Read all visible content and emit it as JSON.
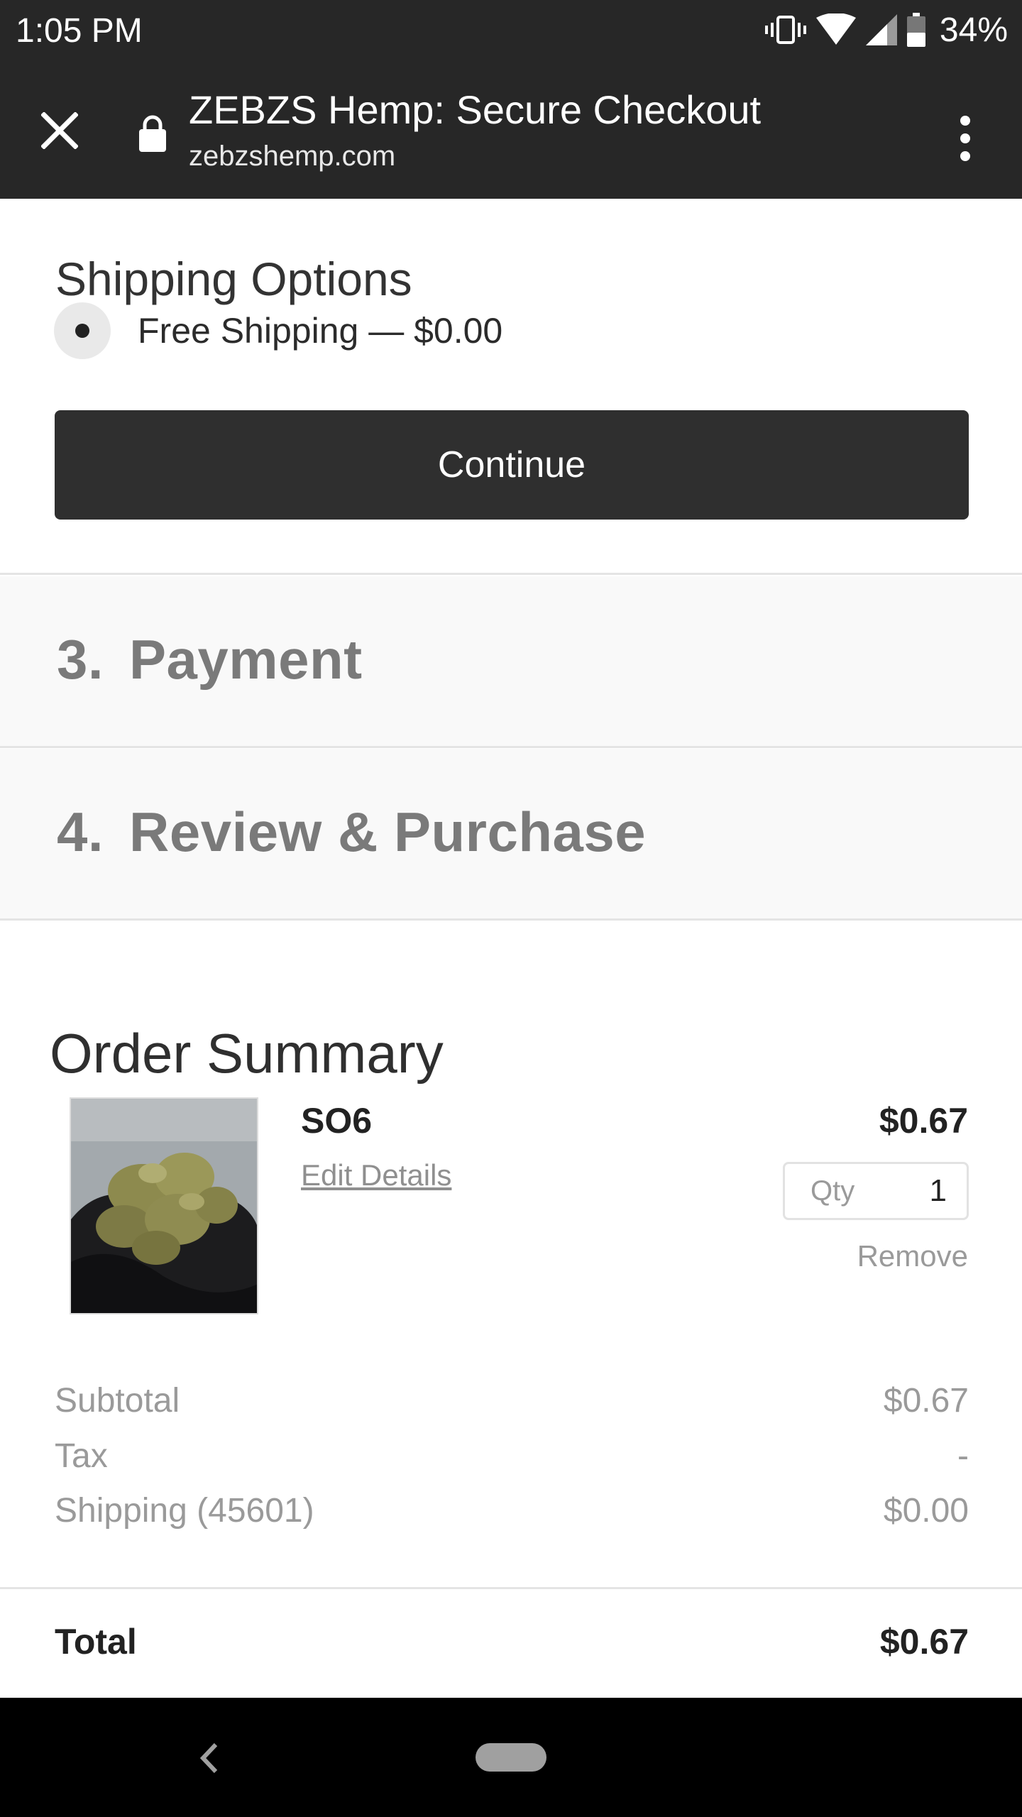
{
  "status_bar": {
    "time": "1:05 PM",
    "battery_percent": "34%",
    "icons": [
      "vibrate-icon",
      "wifi-icon",
      "cell-signal-icon",
      "battery-icon"
    ]
  },
  "toolbar": {
    "title": "ZEBZS Hemp: Secure Checkout",
    "url": "zebzshemp.com",
    "icons": [
      "close-icon",
      "lock-icon",
      "more-vert-icon"
    ]
  },
  "shipping": {
    "heading": "Shipping Options",
    "option_label": "Free Shipping — $0.00",
    "option_selected": true,
    "continue_label": "Continue"
  },
  "steps": [
    {
      "number": "3.",
      "label": "Payment"
    },
    {
      "number": "4.",
      "label": "Review & Purchase"
    }
  ],
  "order_summary": {
    "heading": "Order Summary",
    "item": {
      "name": "SO6",
      "edit_label": "Edit Details",
      "price": "$0.67",
      "qty_label": "Qty",
      "qty_value": "1",
      "remove_label": "Remove"
    },
    "subtotal_label": "Subtotal",
    "subtotal_value": "$0.67",
    "tax_label": "Tax",
    "tax_value": "-",
    "shipping_label": "Shipping (45601)",
    "shipping_value": "$0.00",
    "total_label": "Total",
    "total_value": "$0.67"
  },
  "colors": {
    "toolbar_bg": "#272727",
    "button_bg": "#2f2f2f",
    "step_bg": "#f9f9f9",
    "muted_text": "#9a9a9a"
  }
}
